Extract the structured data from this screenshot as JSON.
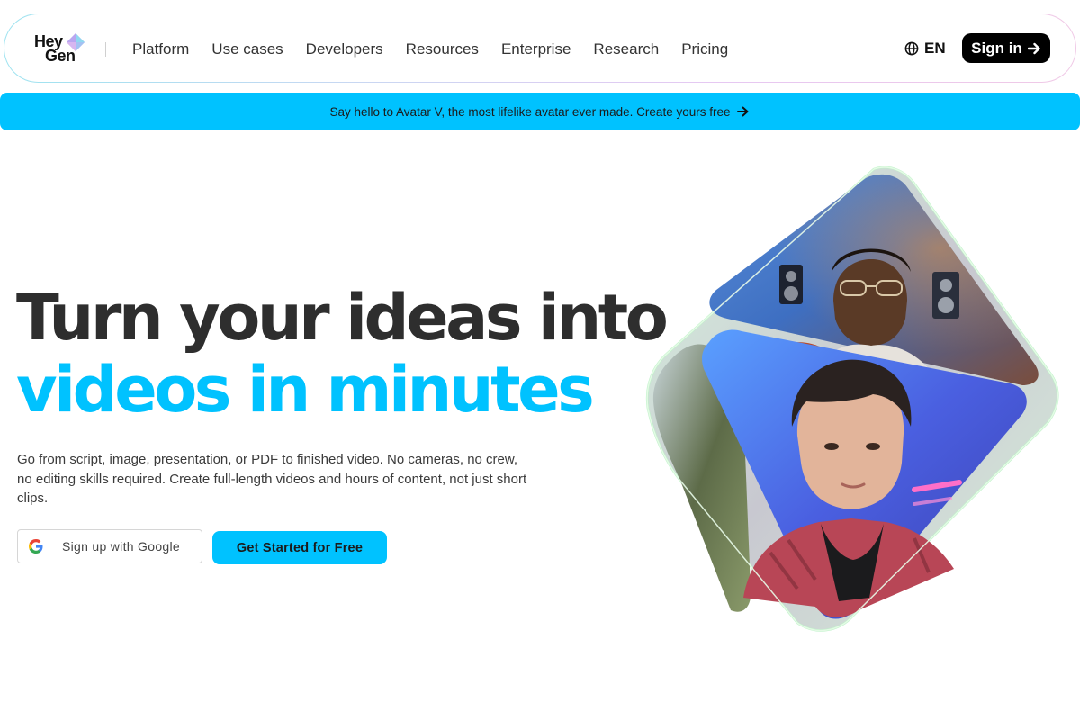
{
  "nav": {
    "logo": {
      "line1": "Hey",
      "line2": "Gen"
    },
    "links": [
      "Platform",
      "Use cases",
      "Developers",
      "Resources",
      "Enterprise",
      "Research",
      "Pricing"
    ],
    "language": "EN",
    "signin_label": "Sign in",
    "icons": {
      "language": "globe-icon",
      "signin": "arrow-right-icon"
    }
  },
  "banner": {
    "text": "Say hello to Avatar V, the most lifelike avatar ever made. Create yours free",
    "icon": "arrow-right-icon"
  },
  "hero": {
    "headline_line1": "Turn your ideas into",
    "headline_line2": "videos in minutes",
    "subtext": "Go from script, image, presentation, or PDF to finished video. No cameras, no crew, no editing skills required. Create full-length videos and hours of content, not just short clips.",
    "google_button_label": "Sign up with Google",
    "cta_label": "Get Started for Free"
  },
  "colors": {
    "accent": "#00c2ff",
    "headline_dark": "#2e2e2e",
    "signin_bg": "#000000"
  }
}
